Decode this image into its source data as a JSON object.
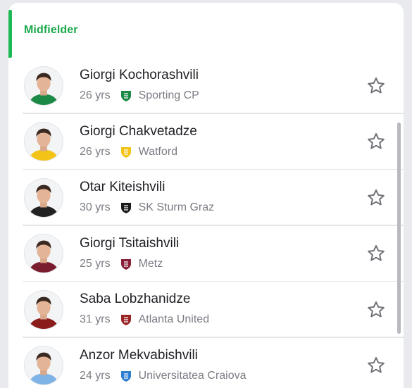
{
  "section": {
    "title": "Midfielder"
  },
  "players": [
    {
      "name": "Giorgi Kochorashvili",
      "age": "26 yrs",
      "club": "Sporting CP",
      "club_icon": "sporting-cp-logo-icon",
      "club_color": "#1b8a46",
      "shirt_color": "#1b8a46"
    },
    {
      "name": "Giorgi Chakvetadze",
      "age": "26 yrs",
      "club": "Watford",
      "club_icon": "watford-logo-icon",
      "club_color": "#f3c316",
      "shirt_color": "#f3c316"
    },
    {
      "name": "Otar Kiteishvili",
      "age": "30 yrs",
      "club": "SK Sturm Graz",
      "club_icon": "sturm-graz-logo-icon",
      "club_color": "#1a1a1a",
      "shirt_color": "#222222"
    },
    {
      "name": "Giorgi Tsitaishvili",
      "age": "25 yrs",
      "club": "Metz",
      "club_icon": "metz-logo-icon",
      "club_color": "#8a1f3a",
      "shirt_color": "#7a1d2e"
    },
    {
      "name": "Saba Lobzhanidze",
      "age": "31 yrs",
      "club": "Atlanta United",
      "club_icon": "atlanta-united-logo-icon",
      "club_color": "#9a2424",
      "shirt_color": "#8a1c1c"
    },
    {
      "name": "Anzor Mekvabishvili",
      "age": "24 yrs",
      "club": "Universitatea Craiova",
      "club_icon": "universitatea-craiova-logo-icon",
      "club_color": "#2f7fd1",
      "shirt_color": "#7fb3e6"
    }
  ],
  "colors": {
    "accent": "#1db954",
    "section_title": "#1aa84b",
    "star_outline": "#6f7178"
  },
  "icons": {
    "favorite": "star-outline-icon",
    "avatar": "player-photo"
  }
}
